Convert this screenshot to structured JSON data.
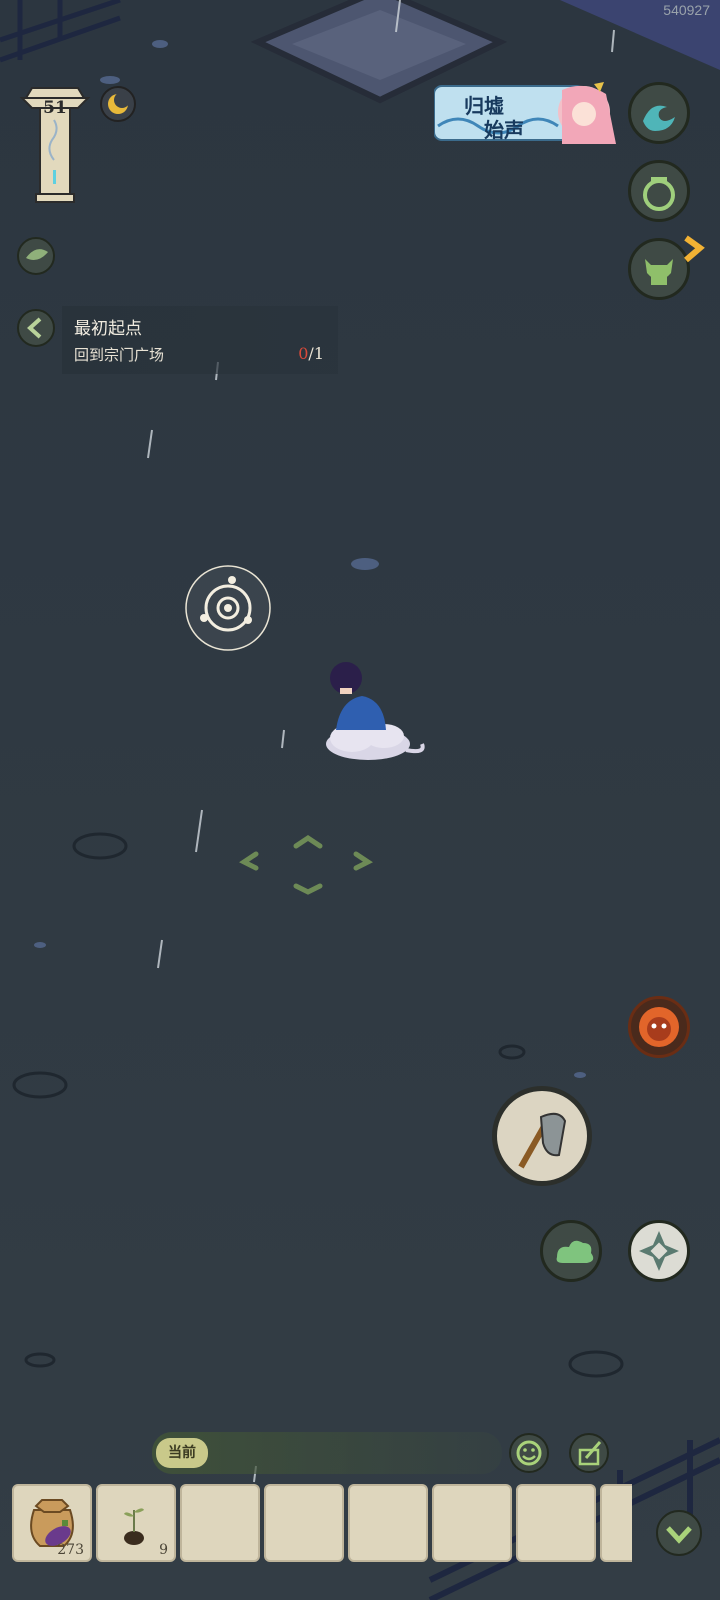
{
  "user_id": "540927",
  "player": {
    "level": "51"
  },
  "quest": {
    "title": "最初起点",
    "desc": "回到宗门广场",
    "progress_current": "0",
    "progress_total": "/1"
  },
  "event_banner": {
    "line1": "归墟",
    "line2": "始声"
  },
  "chat": {
    "channel_tag": "当前"
  },
  "inventory": {
    "slots": [
      {
        "item": "eggplant-seed-bag-icon",
        "count": "273"
      },
      {
        "item": "sprout-icon",
        "count": "9"
      },
      {
        "item": null,
        "count": ""
      },
      {
        "item": null,
        "count": ""
      },
      {
        "item": null,
        "count": ""
      },
      {
        "item": null,
        "count": ""
      },
      {
        "item": null,
        "count": ""
      }
    ]
  },
  "colors": {
    "ground": "#2f3a44",
    "button_green": "#3f4a45",
    "accent_red": "#d94a3a",
    "slot_bg": "#ded6bd"
  }
}
